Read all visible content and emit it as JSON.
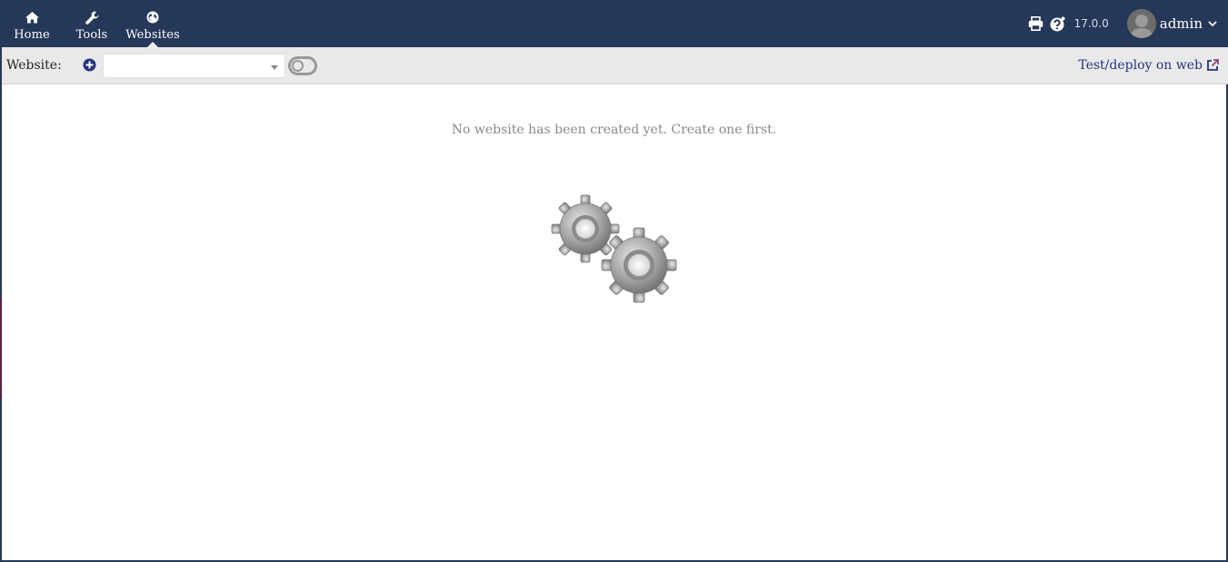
{
  "nav": {
    "items": [
      {
        "label": "Home",
        "icon": "home-icon"
      },
      {
        "label": "Tools",
        "icon": "wrench-icon"
      },
      {
        "label": "Websites",
        "icon": "globe-icon",
        "active": true
      }
    ]
  },
  "header": {
    "version": "17.0.0",
    "user": "admin",
    "icons": [
      "printer-icon",
      "help-icon",
      "avatar",
      "chevron-down-icon"
    ]
  },
  "toolbar": {
    "website_label": "Website:",
    "website_select_value": "",
    "deploy_label": "Test/deploy on web"
  },
  "main": {
    "empty_message": "No website has been created yet. Create one first.",
    "illustration": "gears-icon"
  },
  "colors": {
    "topbar": "#263859",
    "toolbar": "#e9e9e9",
    "link": "#263380",
    "message": "#8a8a8a"
  }
}
